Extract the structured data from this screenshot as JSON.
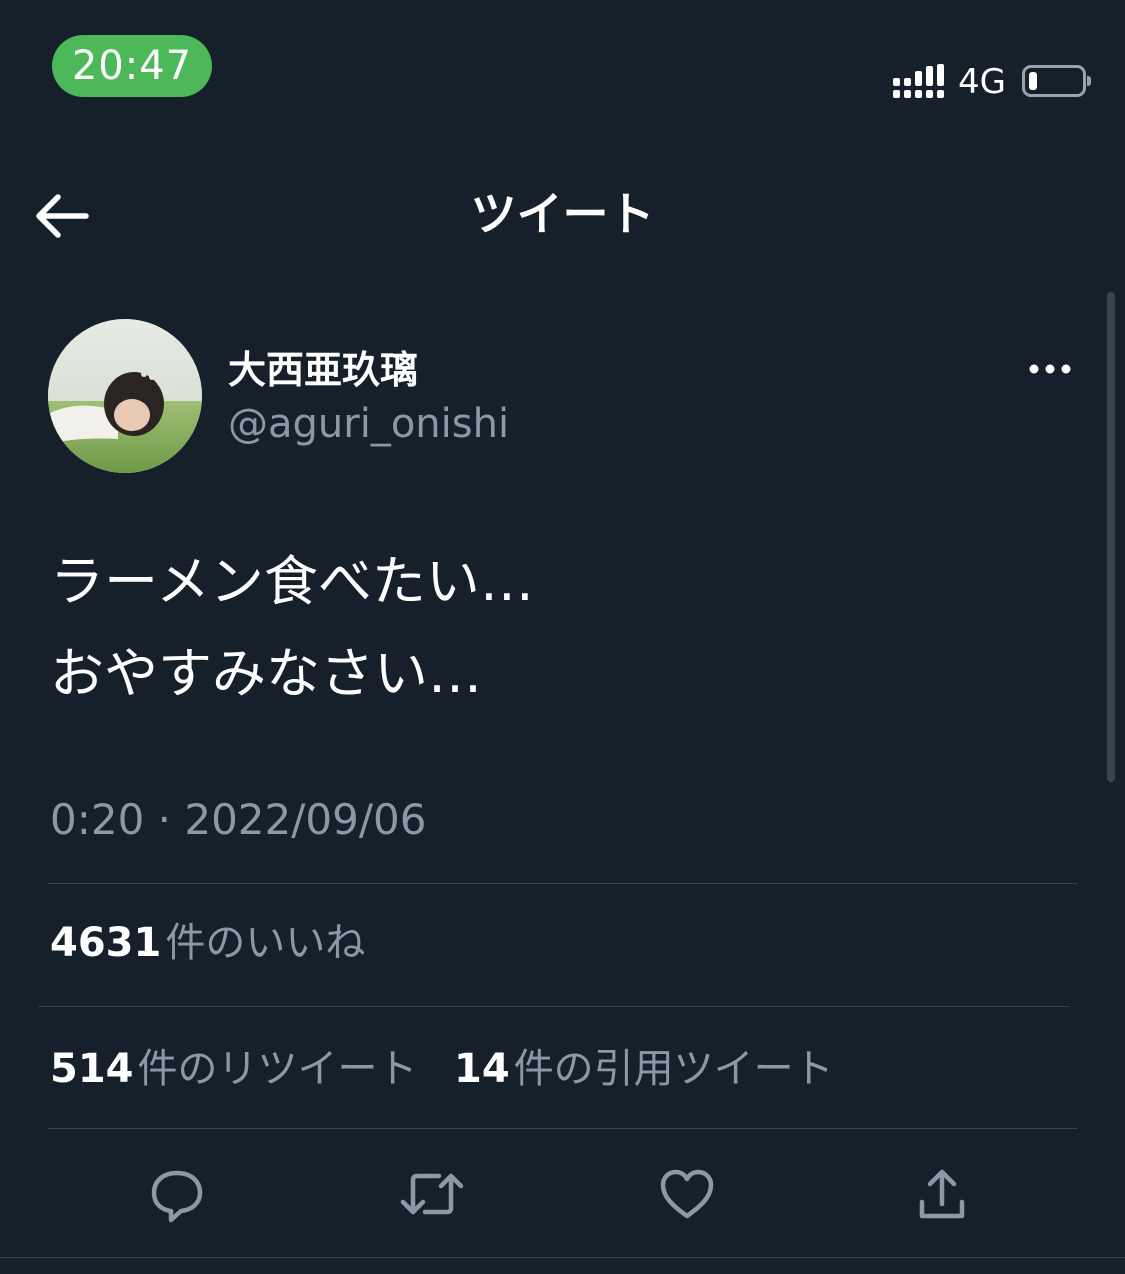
{
  "status_bar": {
    "time": "20:47",
    "network": "4G",
    "battery_level": 0.15
  },
  "header": {
    "title": "ツイート",
    "back_icon": "arrow-left-icon"
  },
  "tweet": {
    "author": {
      "name": "大西亜玖璃",
      "handle": "@aguri_onishi"
    },
    "text_lines": [
      "ラーメン食べたい…",
      "おやすみなさい…"
    ],
    "timestamp": "0:20 · 2022/09/06"
  },
  "stats": {
    "likes": {
      "count": "4631",
      "label": "件のいいね"
    },
    "retweets": {
      "count": "514",
      "label": "件のリツイート"
    },
    "quotes": {
      "count": "14",
      "label": "件の引用ツイート"
    }
  },
  "actions": [
    {
      "icon": "reply-icon"
    },
    {
      "icon": "retweet-icon"
    },
    {
      "icon": "like-icon"
    },
    {
      "icon": "share-icon"
    }
  ],
  "colors": {
    "background": "#15202b",
    "secondary_text": "#8b98a5",
    "divider": "#38444d",
    "time_pill": "#4cb85a"
  }
}
